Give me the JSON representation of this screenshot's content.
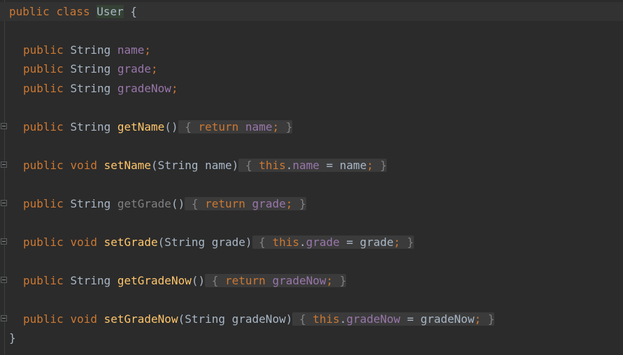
{
  "editor": {
    "class_decl": {
      "kw_public": "public",
      "kw_class": "class",
      "class_name": "User",
      "open_brace": " {"
    },
    "fields": [
      {
        "kw": "public",
        "type": "String",
        "name": "name",
        "semi": ";"
      },
      {
        "kw": "public",
        "type": "String",
        "name": "grade",
        "semi": ";"
      },
      {
        "kw": "public",
        "type": "String",
        "name": "gradeNow",
        "semi": ";"
      }
    ],
    "methods": {
      "getName": {
        "kw": "public",
        "ret": "String",
        "name": "getName",
        "params": "()",
        "body_open": " {",
        "body_kw": "return",
        "body_field": "name",
        "body_semi": ";",
        "body_close": " }"
      },
      "setName": {
        "kw": "public",
        "ret": "void",
        "name": "setName",
        "params": "(String name)",
        "body_open": " {",
        "body_this": "this",
        "body_dot": ".",
        "body_field": "name",
        "body_assign": " = name",
        "body_semi": ";",
        "body_close": " }"
      },
      "getGrade": {
        "kw": "public",
        "ret": "String",
        "name": "getGrade",
        "params": "()",
        "body_open": " {",
        "body_kw": "return",
        "body_field": "grade",
        "body_semi": ";",
        "body_close": " }"
      },
      "setGrade": {
        "kw": "public",
        "ret": "void",
        "name": "setGrade",
        "params": "(String grade)",
        "body_open": " {",
        "body_this": "this",
        "body_dot": ".",
        "body_field": "grade",
        "body_assign": " = grade",
        "body_semi": ";",
        "body_close": " }"
      },
      "getGradeNow": {
        "kw": "public",
        "ret": "String",
        "name": "getGradeNow",
        "params": "()",
        "body_open": " {",
        "body_kw": "return",
        "body_field": "gradeNow",
        "body_semi": ";",
        "body_close": " }"
      },
      "setGradeNow": {
        "kw": "public",
        "ret": "void",
        "name": "setGradeNow",
        "params": "(String gradeNow)",
        "body_open": " {",
        "body_this": "this",
        "body_dot": ".",
        "body_field": "gradeNow",
        "body_assign": " = gradeNow",
        "body_semi": ";",
        "body_close": " }"
      }
    },
    "close_brace": "}"
  },
  "colors": {
    "background": "#2b2b2b",
    "keyword": "#cc7832",
    "field": "#9876aa",
    "method": "#ffc66d",
    "text": "#a9b7c6",
    "unused": "#808080"
  }
}
